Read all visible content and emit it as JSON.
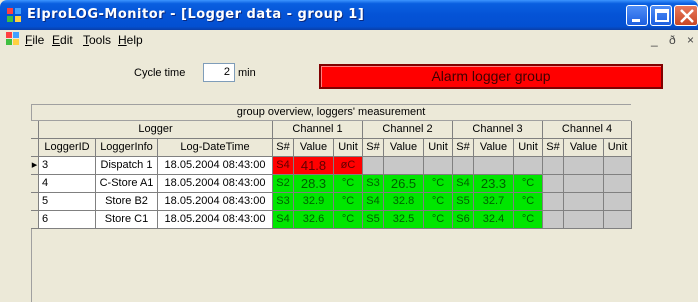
{
  "window": {
    "title": "ElproLOG-Monitor - [Logger data - group 1]"
  },
  "menu": {
    "file": "File",
    "edit": "Edit",
    "tools": "Tools",
    "help": "Help",
    "file_u": "F",
    "file_rest": "ile",
    "edit_u": "E",
    "edit_rest": "dit",
    "tools_u": "T",
    "tools_rest": "ools",
    "help_u": "H",
    "help_rest": "elp"
  },
  "mdi": {
    "min": "_",
    "restore": "ð",
    "close": "×"
  },
  "cycle": {
    "label": "Cycle time",
    "value": "2",
    "unit": "min"
  },
  "alarm": {
    "text": "Alarm logger group",
    "color": "#ff0000"
  },
  "grid": {
    "caption": "group overview, loggers' measurement",
    "group_headers": {
      "logger": "Logger",
      "ch1": "Channel 1",
      "ch2": "Channel 2",
      "ch3": "Channel 3",
      "ch4": "Channel 4"
    },
    "columns": {
      "id": "LoggerID",
      "info": "LoggerInfo",
      "dt": "Log-DateTime",
      "s": "S#",
      "v": "Value",
      "u": "Unit"
    },
    "rows": [
      {
        "id": "3",
        "info": "Dispatch 1",
        "dt": "18.05.2004 08:43:00",
        "ch1": {
          "s": "S4",
          "v": "41.8",
          "u": "øC",
          "state": "alarm"
        },
        "ch2": {
          "s": "",
          "v": "",
          "u": ""
        },
        "ch3": {
          "s": "",
          "v": "",
          "u": ""
        },
        "ch4": {
          "s": "",
          "v": "",
          "u": ""
        }
      },
      {
        "id": "4",
        "info": "C-Store A1",
        "dt": "18.05.2004 08:43:00",
        "ch1": {
          "s": "S2",
          "v": "28.3",
          "u": "°C"
        },
        "ch2": {
          "s": "S3",
          "v": "26.5",
          "u": "°C"
        },
        "ch3": {
          "s": "S4",
          "v": "23.3",
          "u": "°C"
        },
        "ch4": {
          "s": "",
          "v": "",
          "u": ""
        }
      },
      {
        "id": "5",
        "info": "Store B2",
        "dt": "18.05.2004 08:43:00",
        "ch1": {
          "s": "S3",
          "v": "32.9",
          "u": "°C"
        },
        "ch2": {
          "s": "S4",
          "v": "32.8",
          "u": "°C"
        },
        "ch3": {
          "s": "S5",
          "v": "32.7",
          "u": "°C"
        },
        "ch4": {
          "s": "",
          "v": "",
          "u": ""
        }
      },
      {
        "id": "6",
        "info": "Store C1",
        "dt": "18.05.2004 08:43:00",
        "ch1": {
          "s": "S4",
          "v": "32.6",
          "u": "°C"
        },
        "ch2": {
          "s": "S5",
          "v": "32.5",
          "u": "°C"
        },
        "ch3": {
          "s": "S6",
          "v": "32.4",
          "u": "°C"
        },
        "ch4": {
          "s": "",
          "v": "",
          "u": ""
        }
      }
    ]
  },
  "colors": {
    "alarm": "#ff0000",
    "ok": "#00e600",
    "empty": "#c8c8c8"
  }
}
